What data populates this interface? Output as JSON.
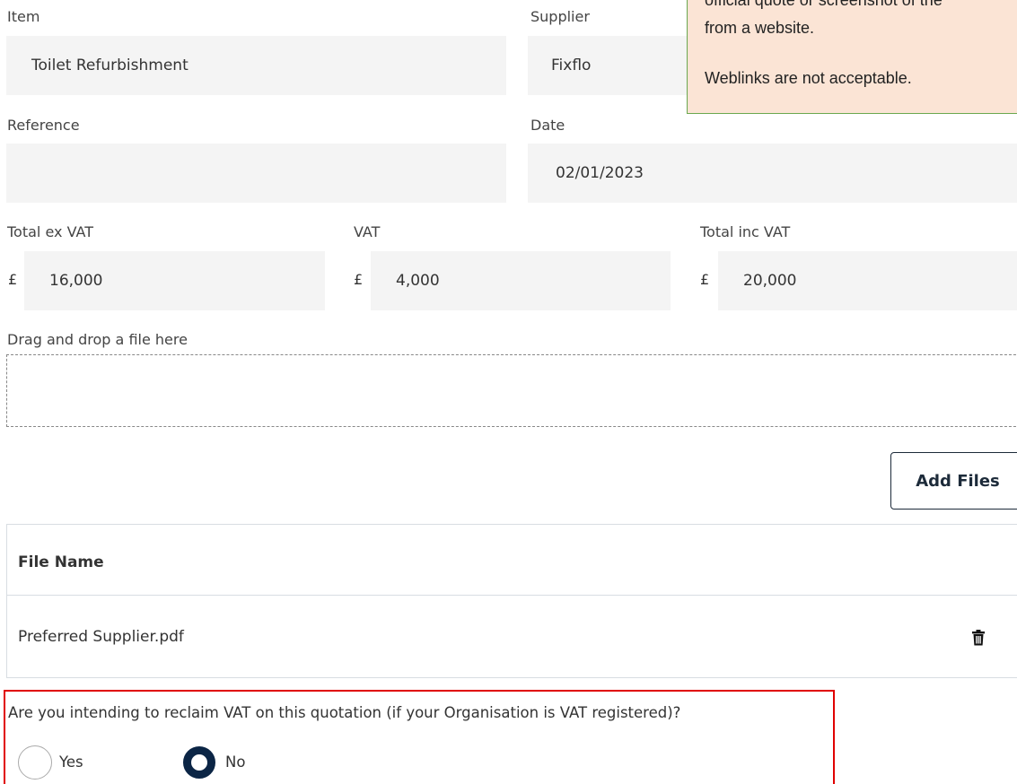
{
  "callout": {
    "line1_partial": "official quote or screenshot of the",
    "line2": "from a website.",
    "line3": "Weblinks are not acceptable."
  },
  "form": {
    "item": {
      "label": "Item",
      "value": "Toilet Refurbishment"
    },
    "supplier": {
      "label": "Supplier",
      "value": "Fixflo"
    },
    "reference": {
      "label": "Reference",
      "value": ""
    },
    "date": {
      "label": "Date",
      "value": "02/01/2023"
    },
    "total_ex_vat": {
      "label": "Total ex VAT",
      "currency": "£",
      "value": "16,000"
    },
    "vat": {
      "label": "VAT",
      "currency": "£",
      "value": "4,000"
    },
    "total_inc_vat": {
      "label": "Total inc VAT",
      "currency": "£",
      "value": "20,000"
    }
  },
  "upload": {
    "label": "Drag and drop a file here",
    "add_button": "Add Files"
  },
  "files_table": {
    "header": "File Name",
    "rows": [
      {
        "name": "Preferred Supplier.pdf"
      }
    ]
  },
  "vat_question": {
    "text": "Are you intending to reclaim VAT on this quotation (if your Organisation is VAT registered)?",
    "options": [
      {
        "label": "Yes",
        "selected": false
      },
      {
        "label": "No",
        "selected": true
      }
    ]
  },
  "colors": {
    "field_bg": "#f4f4f4",
    "callout_bg": "#fbe4d5",
    "callout_border": "#6aa84f",
    "question_border": "#e00000",
    "radio_selected": "#0b2545"
  },
  "icons": {
    "delete": "trash-icon"
  }
}
